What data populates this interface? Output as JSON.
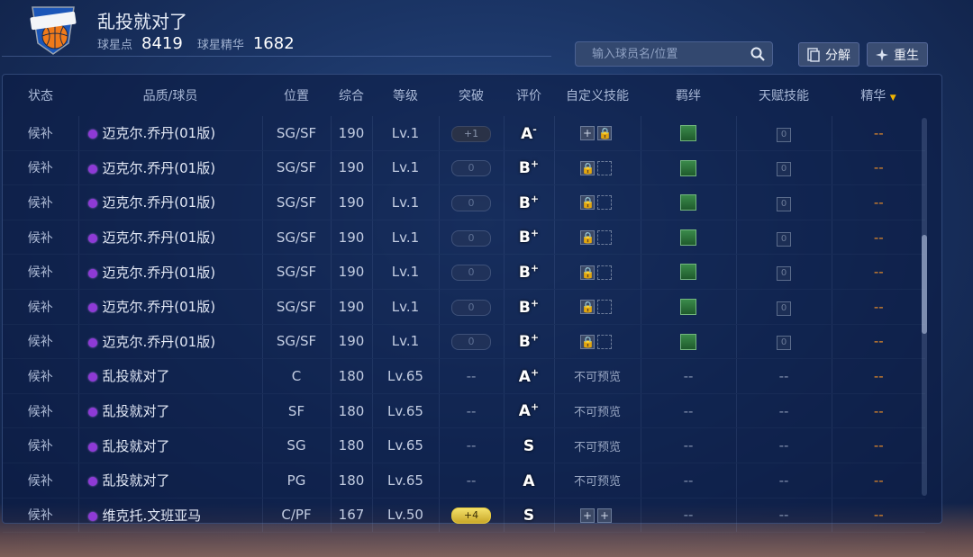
{
  "header": {
    "team_name": "乱投就对了",
    "star_points_label": "球星点",
    "star_points_value": "8419",
    "star_essence_label": "球星精华",
    "star_essence_value": "1682"
  },
  "search": {
    "placeholder": "输入球员名/位置"
  },
  "buttons": {
    "decompose": "分解",
    "reborn": "重生"
  },
  "columns": [
    "状态",
    "品质/球员",
    "位置",
    "综合",
    "等级",
    "突破",
    "评价",
    "自定义技能",
    "羁绊",
    "天赋技能",
    "精华"
  ],
  "rows": [
    {
      "status": "候补",
      "name": "迈克尔.乔丹(01版)",
      "position": "SG/SF",
      "overall": "190",
      "level": "Lv.1",
      "breakthrough": "+1",
      "bt_style": "dark",
      "grade": "A",
      "grade_sup": "-",
      "skill": "boxes",
      "skill_text": "",
      "talent": "0",
      "essence": "--"
    },
    {
      "status": "候补",
      "name": "迈克尔.乔丹(01版)",
      "position": "SG/SF",
      "overall": "190",
      "level": "Lv.1",
      "breakthrough": "0",
      "bt_style": "plain",
      "grade": "B",
      "grade_sup": "+",
      "skill": "boxes",
      "skill_text": "",
      "talent": "0",
      "essence": "--"
    },
    {
      "status": "候补",
      "name": "迈克尔.乔丹(01版)",
      "position": "SG/SF",
      "overall": "190",
      "level": "Lv.1",
      "breakthrough": "0",
      "bt_style": "plain",
      "grade": "B",
      "grade_sup": "+",
      "skill": "boxes",
      "skill_text": "",
      "talent": "0",
      "essence": "--"
    },
    {
      "status": "候补",
      "name": "迈克尔.乔丹(01版)",
      "position": "SG/SF",
      "overall": "190",
      "level": "Lv.1",
      "breakthrough": "0",
      "bt_style": "plain",
      "grade": "B",
      "grade_sup": "+",
      "skill": "boxes",
      "skill_text": "",
      "talent": "0",
      "essence": "--"
    },
    {
      "status": "候补",
      "name": "迈克尔.乔丹(01版)",
      "position": "SG/SF",
      "overall": "190",
      "level": "Lv.1",
      "breakthrough": "0",
      "bt_style": "plain",
      "grade": "B",
      "grade_sup": "+",
      "skill": "boxes",
      "skill_text": "",
      "talent": "0",
      "essence": "--"
    },
    {
      "status": "候补",
      "name": "迈克尔.乔丹(01版)",
      "position": "SG/SF",
      "overall": "190",
      "level": "Lv.1",
      "breakthrough": "0",
      "bt_style": "plain",
      "grade": "B",
      "grade_sup": "+",
      "skill": "boxes",
      "skill_text": "",
      "talent": "0",
      "essence": "--"
    },
    {
      "status": "候补",
      "name": "迈克尔.乔丹(01版)",
      "position": "SG/SF",
      "overall": "190",
      "level": "Lv.1",
      "breakthrough": "0",
      "bt_style": "plain",
      "grade": "B",
      "grade_sup": "+",
      "skill": "boxes",
      "skill_text": "",
      "talent": "0",
      "essence": "--"
    },
    {
      "status": "候补",
      "name": "乱投就对了",
      "position": "C",
      "overall": "180",
      "level": "Lv.65",
      "breakthrough": "--",
      "bt_style": "none",
      "grade": "A",
      "grade_sup": "+",
      "skill": "text",
      "skill_text": "不可预览",
      "talent": "--",
      "essence": "--"
    },
    {
      "status": "候补",
      "name": "乱投就对了",
      "position": "SF",
      "overall": "180",
      "level": "Lv.65",
      "breakthrough": "--",
      "bt_style": "none",
      "grade": "A",
      "grade_sup": "+",
      "skill": "text",
      "skill_text": "不可预览",
      "talent": "--",
      "essence": "--"
    },
    {
      "status": "候补",
      "name": "乱投就对了",
      "position": "SG",
      "overall": "180",
      "level": "Lv.65",
      "breakthrough": "--",
      "bt_style": "none",
      "grade": "S",
      "grade_sup": "",
      "skill": "text",
      "skill_text": "不可预览",
      "talent": "--",
      "essence": "--"
    },
    {
      "status": "候补",
      "name": "乱投就对了",
      "position": "PG",
      "overall": "180",
      "level": "Lv.65",
      "breakthrough": "--",
      "bt_style": "none",
      "grade": "A",
      "grade_sup": "",
      "skill": "text",
      "skill_text": "不可预览",
      "talent": "--",
      "essence": "--"
    },
    {
      "status": "候补",
      "name": "维克托.文班亚马",
      "position": "C/PF",
      "overall": "167",
      "level": "Lv.50",
      "breakthrough": "+4",
      "bt_style": "gold",
      "grade": "S",
      "grade_sup": "",
      "skill": "plus",
      "skill_text": "",
      "talent": "--",
      "essence": "--"
    }
  ],
  "bond_placeholder": "--",
  "colors": {
    "accent_orange": "#e48a2a",
    "quality_purple": "#8e3ad6",
    "gold_pill": "#e9cc3e"
  }
}
